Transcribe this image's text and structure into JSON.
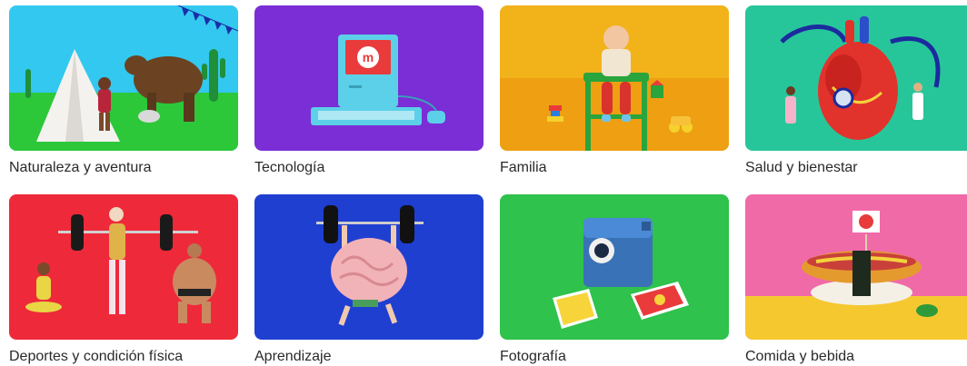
{
  "categories": [
    {
      "label": "Naturaleza y aventura",
      "icon": "nature-adventure-image"
    },
    {
      "label": "Tecnología",
      "icon": "technology-image"
    },
    {
      "label": "Familia",
      "icon": "family-image"
    },
    {
      "label": "Salud y bienestar",
      "icon": "health-wellness-image"
    },
    {
      "label": "Deportes y condición física",
      "icon": "sports-fitness-image"
    },
    {
      "label": "Aprendizaje",
      "icon": "learning-image"
    },
    {
      "label": "Fotografía",
      "icon": "photography-image"
    },
    {
      "label": "Comida y bebida",
      "icon": "food-drink-image"
    }
  ],
  "colors": {
    "nature_bg": "#33c8ef",
    "technology_bg": "#7b2dd6",
    "family_bg": "#f2b21a",
    "health_bg": "#27c69a",
    "sports_bg": "#ee2a3a",
    "learning_bg": "#1f3fd1",
    "photography_bg": "#2fc24c",
    "food_bg": "#f06aa8"
  }
}
